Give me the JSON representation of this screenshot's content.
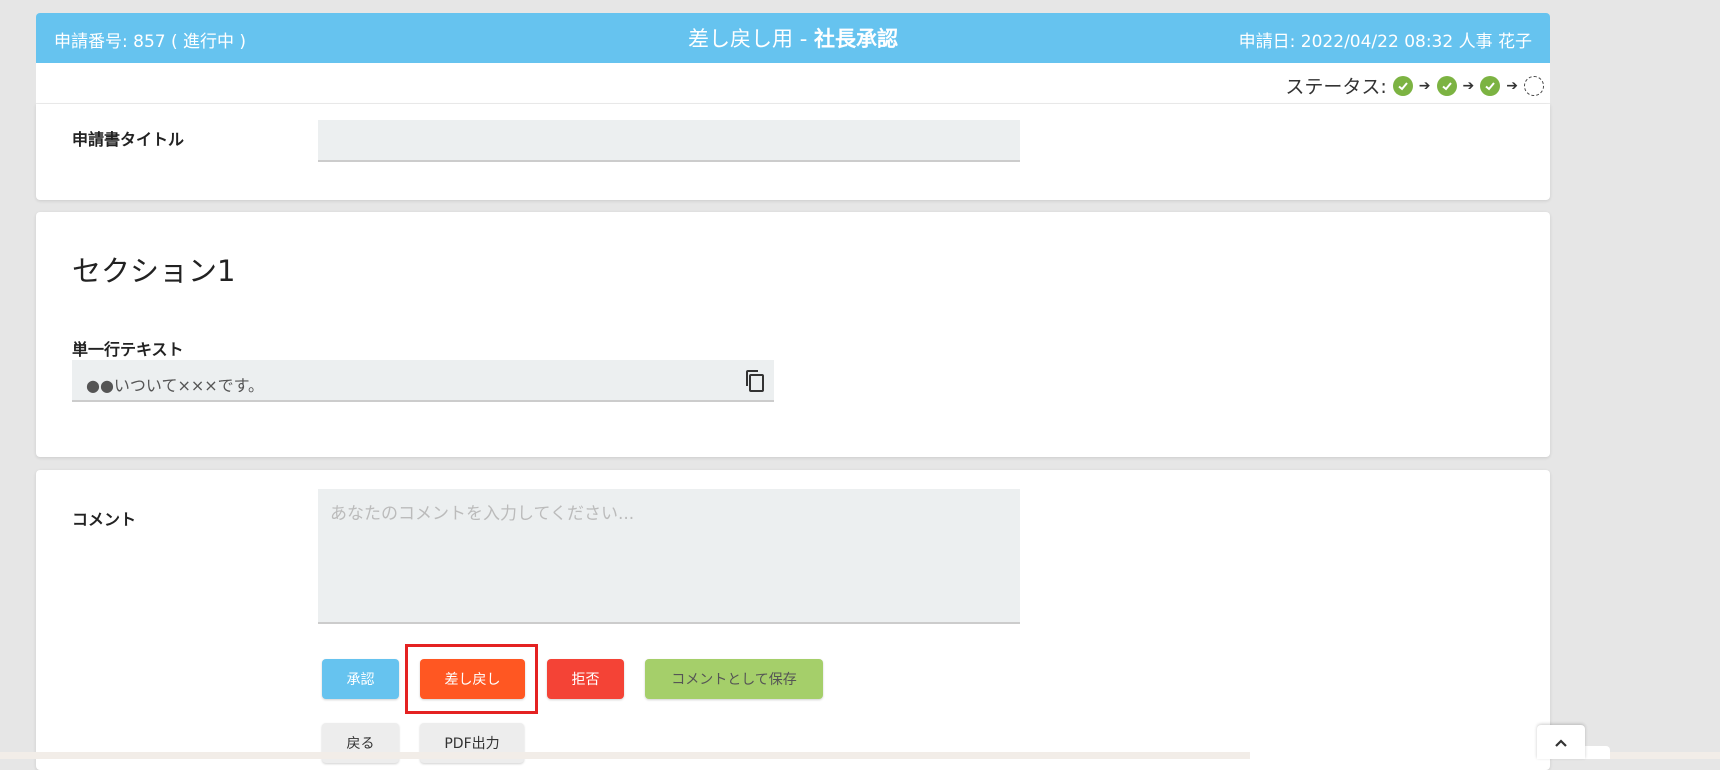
{
  "header": {
    "request_no": "申請番号: 857 ( 進行中 )",
    "title_prefix": "差し戻し用 - ",
    "title_bold": "社長承認",
    "date_user": "申請日: 2022/04/22 08:32  人事 花子",
    "color": "#66c3ef"
  },
  "status": {
    "label": "ステータス:",
    "steps": [
      "done",
      "done",
      "done",
      "pending"
    ],
    "done_color": "#7cb342"
  },
  "form": {
    "title_label": "申請書タイトル",
    "title_value": "",
    "section_title": "セクション1",
    "field_label": "単一行テキスト",
    "field_value": "●●いついて×××です。",
    "copy_icon": "copy-icon"
  },
  "comment": {
    "label": "コメント",
    "placeholder": "あなたのコメントを入力してください..."
  },
  "buttons": {
    "approve": "承認",
    "return": "差し戻し",
    "reject": "拒否",
    "save_comment": "コメントとして保存",
    "back": "戻る",
    "pdf": "PDF出力"
  },
  "colors": {
    "approve": "#66c3ef",
    "return": "#ff5722",
    "reject": "#f44336",
    "save_comment": "#a5cf6a",
    "highlight": "#e42222"
  },
  "scroll_top_icon": "chevron-up-icon"
}
